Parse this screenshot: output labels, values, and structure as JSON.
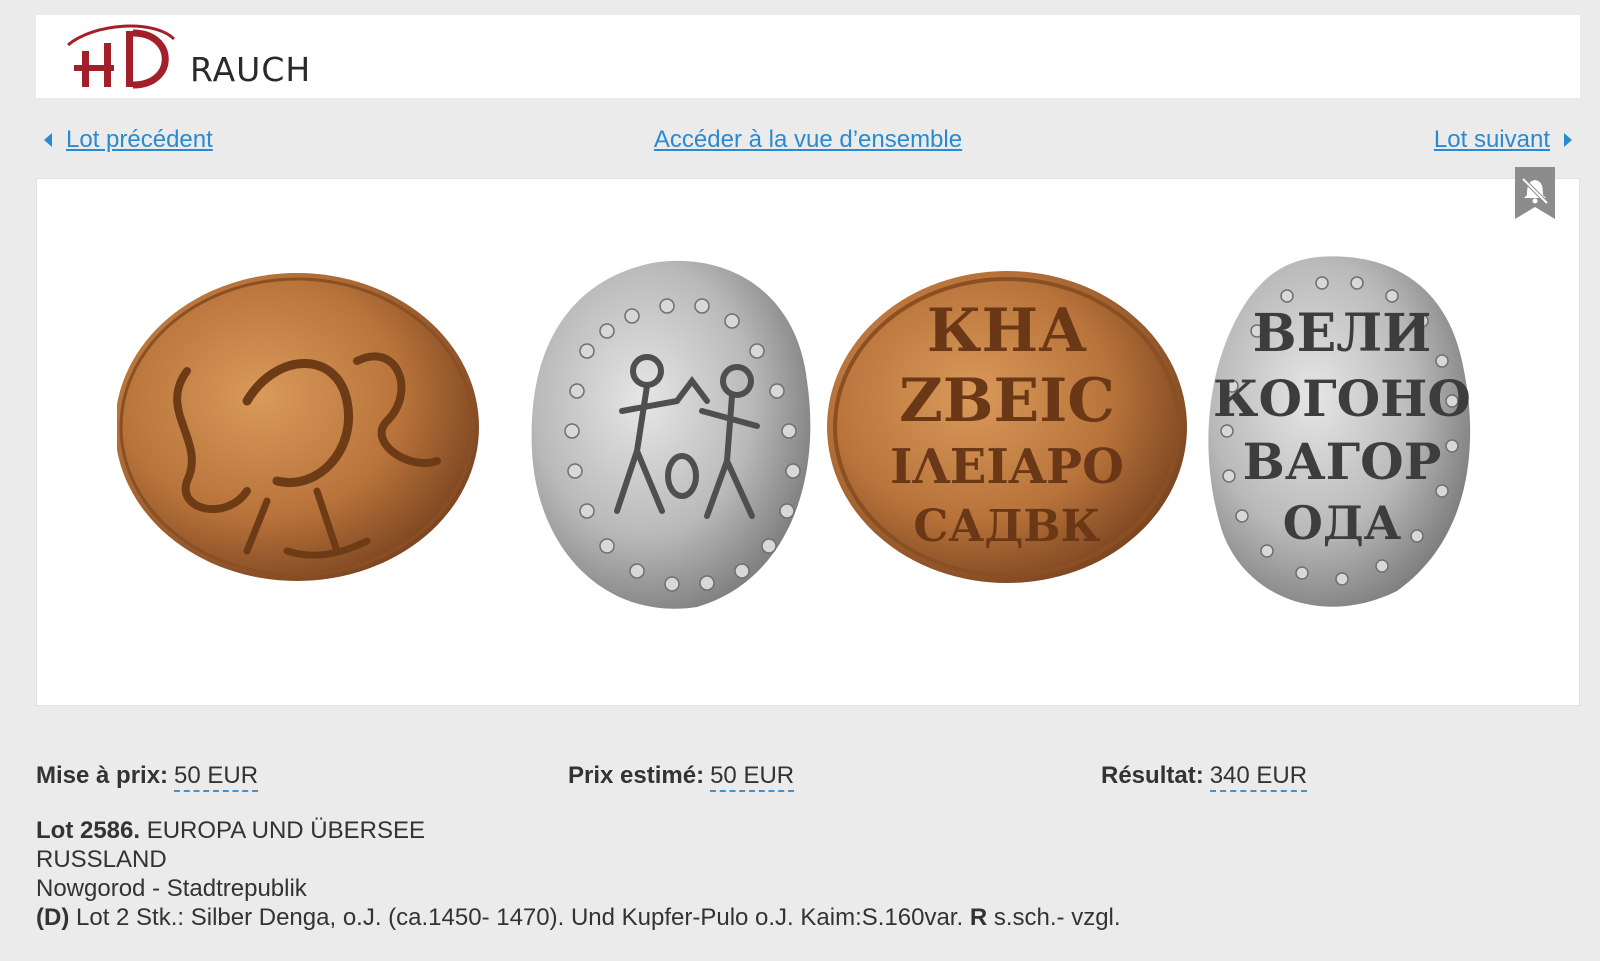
{
  "header": {
    "logo_text": "RAUCH",
    "logo_mark": "HD",
    "brand_color": "#a31f2a"
  },
  "nav": {
    "prev_label": "Lot précédent",
    "overview_label": "Accéder à la vue d’ensemble",
    "next_label": "Lot suivant",
    "link_color": "#2a8ad0"
  },
  "image": {
    "bookmark_icon": "bell-slash-icon",
    "coin_inscriptions": {
      "coin3": [
        "КНА",
        "ZΒΕΙС",
        "ΙΛΕΙΑΡΟ",
        "САДВК"
      ],
      "coin4": [
        "ВЕЛИ",
        "КОГОНО",
        "ВАГОР",
        "ОДА"
      ]
    }
  },
  "prices": {
    "start_label": "Mise à prix:",
    "start_value": "50 EUR",
    "estimate_label": "Prix estimé:",
    "estimate_value": "50 EUR",
    "result_label": "Résultat:",
    "result_value": "340 EUR"
  },
  "lot": {
    "number": "Lot 2586.",
    "category": "EUROPA UND ÜBERSEE",
    "country": "RUSSLAND",
    "region": "Nowgorod - Stadtrepublik",
    "prefix": "(D)",
    "text": "Lot 2 Stk.: Silber Denga, o.J. (ca.1450- 1470). Und Kupfer-Pulo o.J. Kaim:S.160var.",
    "rarity": "R",
    "grade": "s.sch.- vzgl."
  }
}
